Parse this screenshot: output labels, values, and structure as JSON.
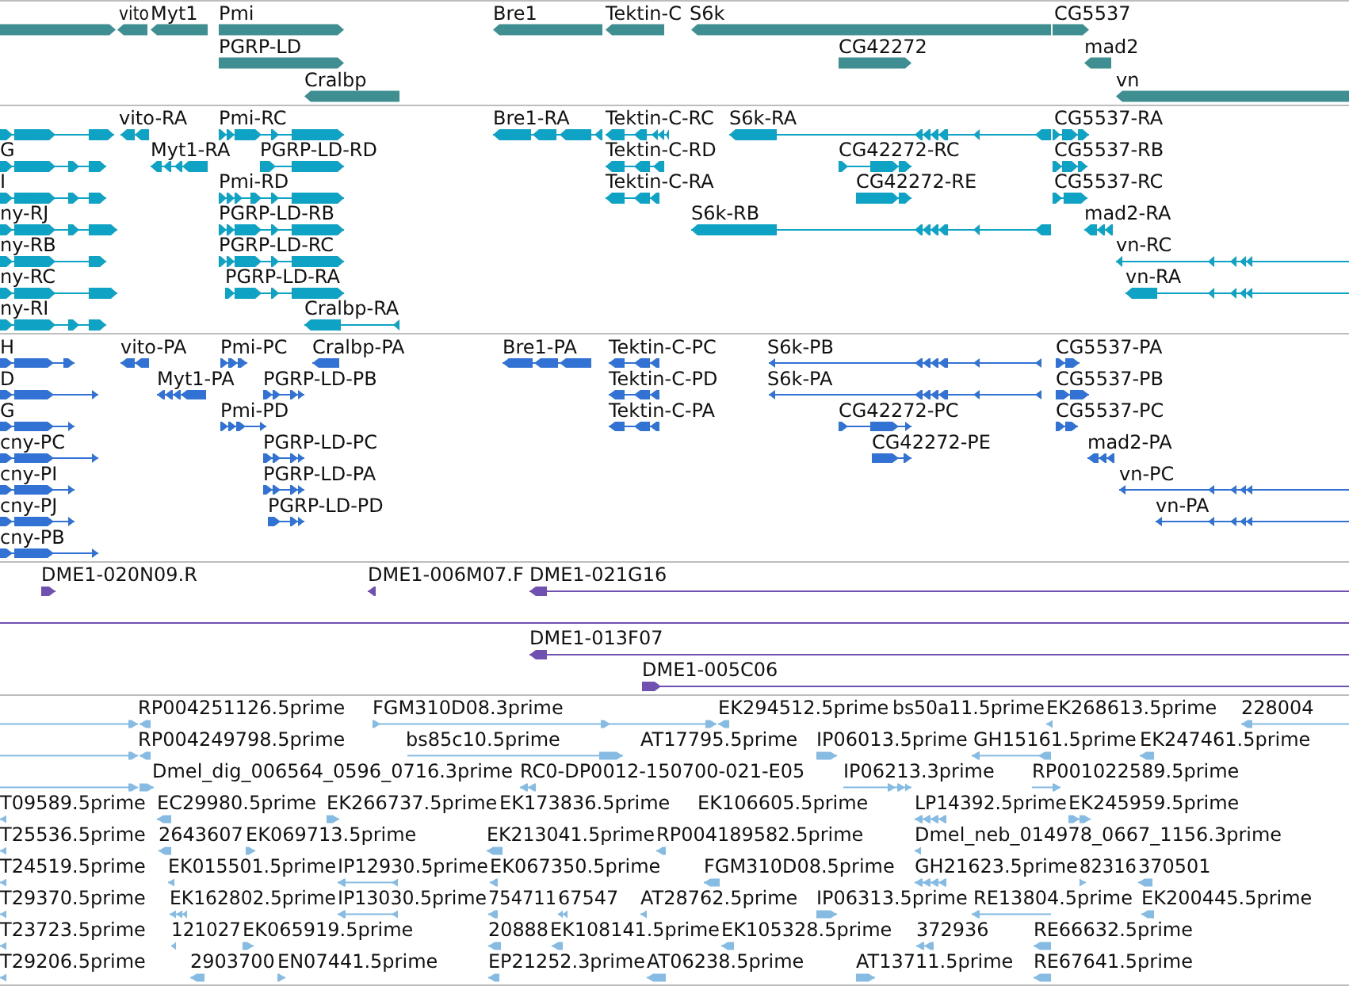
{
  "tracks": [
    {
      "kind": "gene",
      "rows": [
        {
          "features": [
            {
              "reverse": false
            },
            {
              "label": "vito",
              "reverse": true
            },
            {
              "label": "Myt1",
              "reverse": true
            },
            {
              "label": "Pmi",
              "reverse": false
            },
            {
              "label": "Bre1",
              "reverse": true
            },
            {
              "label": "Tektin-C",
              "reverse": true
            },
            {
              "label": "S6k",
              "reverse": true
            },
            {
              "label": "CG5537",
              "reverse": false
            }
          ]
        },
        {
          "features": [
            {
              "label": "PGRP-LD",
              "reverse": false
            },
            {
              "label": "CG42272",
              "reverse": false
            },
            {
              "label": "mad2",
              "reverse": true
            }
          ]
        },
        {
          "features": [
            {
              "label": "Cralbp",
              "reverse": true
            },
            {
              "label": "vn",
              "reverse": true
            }
          ]
        }
      ]
    },
    {
      "kind": "transcript",
      "rows": [
        {
          "features": [
            {
              "reverse": false
            },
            {
              "label": "vito-RA",
              "reverse": true
            },
            {
              "label": "Pmi-RC",
              "reverse": false
            },
            {
              "label": "Bre1-RA",
              "reverse": true
            },
            {
              "label": "Tektin-C-RC",
              "reverse": true
            },
            {
              "label": "S6k-RA",
              "reverse": true
            },
            {
              "label": "CG5537-RA",
              "reverse": false
            }
          ]
        },
        {
          "features": [
            {
              "label": "G",
              "reverse": false
            },
            {
              "label": "Myt1-RA",
              "reverse": true
            },
            {
              "label": "PGRP-LD-RD",
              "reverse": false
            },
            {
              "label": "Tektin-C-RD",
              "reverse": true
            },
            {
              "label": "CG42272-RC",
              "reverse": false
            },
            {
              "label": "CG5537-RB",
              "reverse": false
            }
          ]
        },
        {
          "features": [
            {
              "label": "I",
              "reverse": false
            },
            {
              "label": "Pmi-RD",
              "reverse": false
            },
            {
              "label": "Tektin-C-RA",
              "reverse": true
            },
            {
              "label": "CG42272-RE",
              "reverse": false
            },
            {
              "label": "CG5537-RC",
              "reverse": false
            }
          ]
        },
        {
          "features": [
            {
              "label": "ny-RJ",
              "reverse": false
            },
            {
              "label": "PGRP-LD-RB",
              "reverse": false
            },
            {
              "label": "S6k-RB",
              "reverse": true
            },
            {
              "label": "mad2-RA",
              "reverse": true
            }
          ]
        },
        {
          "features": [
            {
              "label": "ny-RB",
              "reverse": false
            },
            {
              "label": "PGRP-LD-RC",
              "reverse": false
            },
            {
              "label": "vn-RC",
              "reverse": true
            }
          ]
        },
        {
          "features": [
            {
              "label": "ny-RC",
              "reverse": false
            },
            {
              "label": "PGRP-LD-RA",
              "reverse": false
            },
            {
              "label": "vn-RA",
              "reverse": true
            }
          ]
        },
        {
          "features": [
            {
              "label": "ny-RI",
              "reverse": false
            },
            {
              "label": "Cralbp-RA",
              "reverse": true
            }
          ]
        }
      ]
    },
    {
      "kind": "protein",
      "rows": [
        {
          "features": [
            {
              "label": "H",
              "reverse": false
            },
            {
              "label": "vito-PA",
              "reverse": true
            },
            {
              "label": "Pmi-PC",
              "reverse": false
            },
            {
              "label": "Cralbp-PA",
              "reverse": true
            },
            {
              "label": "Bre1-PA",
              "reverse": true
            },
            {
              "label": "Tektin-C-PC",
              "reverse": true
            },
            {
              "label": "S6k-PB",
              "reverse": true
            },
            {
              "label": "CG5537-PA",
              "reverse": false
            }
          ]
        },
        {
          "features": [
            {
              "label": "D",
              "reverse": false
            },
            {
              "label": "Myt1-PA",
              "reverse": true
            },
            {
              "label": "PGRP-LD-PB",
              "reverse": false
            },
            {
              "label": "Tektin-C-PD",
              "reverse": true
            },
            {
              "label": "S6k-PA",
              "reverse": true
            },
            {
              "label": "CG5537-PB",
              "reverse": false
            }
          ]
        },
        {
          "features": [
            {
              "label": "G",
              "reverse": false
            },
            {
              "label": "Pmi-PD",
              "reverse": false
            },
            {
              "label": "Tektin-C-PA",
              "reverse": true
            },
            {
              "label": "CG42272-PC",
              "reverse": false
            },
            {
              "label": "CG5537-PC",
              "reverse": false
            }
          ]
        },
        {
          "features": [
            {
              "label": "cny-PC",
              "reverse": false
            },
            {
              "label": "PGRP-LD-PC",
              "reverse": false
            },
            {
              "label": "CG42272-PE",
              "reverse": false
            },
            {
              "label": "mad2-PA",
              "reverse": true
            }
          ]
        },
        {
          "features": [
            {
              "label": "cny-PI",
              "reverse": false
            },
            {
              "label": "PGRP-LD-PA",
              "reverse": false
            },
            {
              "label": "vn-PC",
              "reverse": true
            }
          ]
        },
        {
          "features": [
            {
              "label": "cny-PJ",
              "reverse": false
            },
            {
              "label": "PGRP-LD-PD",
              "reverse": false
            },
            {
              "label": "vn-PA",
              "reverse": true
            }
          ]
        },
        {
          "features": [
            {
              "label": "cny-PB",
              "reverse": false
            }
          ]
        }
      ]
    },
    {
      "kind": "clone",
      "rows": [
        {
          "features": [
            {
              "label": "DME1-020N09.R",
              "reverse": false
            },
            {
              "label": "DME1-006M07.F",
              "reverse": true
            },
            {
              "label": "DME1-021G16",
              "reverse": true
            }
          ]
        },
        {
          "features": [
            {
              "spans_view": true
            }
          ]
        },
        {
          "features": [
            {
              "label": "DME1-013F07",
              "reverse": true
            }
          ]
        },
        {
          "features": [
            {
              "label": "DME1-005C06",
              "reverse": false
            }
          ]
        }
      ]
    },
    {
      "kind": "est",
      "rows": [
        {
          "features": [
            {
              "reverse": false
            },
            {
              "label": "RP004251126.5prime",
              "reverse": true
            },
            {
              "label": "FGM310D08.3prime",
              "reverse": false
            },
            {
              "label": "EK294512.5prime",
              "reverse": true
            },
            {
              "label": "bs50a11.5prime"
            },
            {
              "label": "EK268613.5prime",
              "reverse": true
            },
            {
              "label": "228004",
              "reverse": true
            }
          ]
        },
        {
          "features": [
            {
              "reverse": false
            },
            {
              "label": "RP004249798.5prime",
              "reverse": true
            },
            {
              "label": "bs85c10.5prime",
              "reverse": false
            },
            {
              "label": "AT17795.5prime"
            },
            {
              "label": "IP06013.5prime",
              "reverse": false
            },
            {
              "label": "GH15161.5prime",
              "reverse": true
            },
            {
              "label": "EK247461.5prime",
              "reverse": true
            }
          ]
        },
        {
          "features": [
            {
              "reverse": false
            },
            {
              "label": "Dmel_dig_006564_0596_0716.3prime",
              "reverse": false
            },
            {
              "label": "RC0-DP0012-150700-021-E05",
              "reverse": true
            },
            {
              "label": "IP06213.3prime",
              "reverse": false
            },
            {
              "label": "RP001022589.5prime",
              "reverse": false
            }
          ]
        },
        {
          "features": [
            {
              "label": "T09589.5prime",
              "reverse": true
            },
            {
              "label": "EC29980.5prime",
              "reverse": true
            },
            {
              "label": "EK266737.5prime",
              "reverse": false
            },
            {
              "label": "EK173836.5prime"
            },
            {
              "label": "EK106605.5prime"
            },
            {
              "label": "LP14392.5prime",
              "reverse": true
            },
            {
              "label": "EK245959.5prime",
              "reverse": false
            }
          ]
        },
        {
          "features": [
            {
              "label": "T25536.5prime",
              "reverse": true
            },
            {
              "label": "2643607",
              "reverse": true
            },
            {
              "label": "EK069713.5prime",
              "reverse": false
            },
            {
              "label": "EK213041.5prime",
              "reverse": true
            },
            {
              "label": "RP004189582.5prime",
              "reverse": true
            },
            {
              "label": "Dmel_neb_014978_0667_1156.3prime",
              "reverse": true
            }
          ]
        },
        {
          "features": [
            {
              "label": "T24519.5prime",
              "reverse": true
            },
            {
              "label": "EK015501.5prime",
              "reverse": true
            },
            {
              "label": "IP12930.5prime",
              "reverse": true
            },
            {
              "label": "EK067350.5prime",
              "reverse": true
            },
            {
              "label": "FGM310D08.5prime",
              "reverse": true
            },
            {
              "label": "GH21623.5prime",
              "reverse": true
            },
            {
              "label": "82316",
              "reverse": false
            },
            {
              "label": "370501",
              "reverse": true
            }
          ]
        },
        {
          "features": [
            {
              "label": "T29370.5prime",
              "reverse": true
            },
            {
              "label": "EK162802.5prime",
              "reverse": true
            },
            {
              "label": "IP13030.5prime",
              "reverse": true
            },
            {
              "label": "754711",
              "reverse": true
            },
            {
              "label": "67547",
              "reverse": true
            },
            {
              "label": "AT28762.5prime",
              "reverse": true
            },
            {
              "label": "IP06313.5prime",
              "reverse": false
            },
            {
              "label": "RE13804.5prime",
              "reverse": true
            },
            {
              "label": "EK200445.5prime",
              "reverse": true
            }
          ]
        },
        {
          "features": [
            {
              "label": "T23723.5prime",
              "reverse": true
            },
            {
              "label": "121027",
              "reverse": true
            },
            {
              "label": "EK065919.5prime",
              "reverse": false
            },
            {
              "label": "20888",
              "reverse": true
            },
            {
              "label": "EK108141.5prime",
              "reverse": true
            },
            {
              "label": "EK105328.5prime",
              "reverse": true
            },
            {
              "label": "372936",
              "reverse": true
            },
            {
              "label": "RE66632.5prime",
              "reverse": true
            }
          ]
        },
        {
          "features": [
            {
              "label": "T29206.5prime",
              "reverse": true
            },
            {
              "label": "2903700",
              "reverse": true
            },
            {
              "label": "EN07441.5prime",
              "reverse": false
            },
            {
              "label": "EP21252.3prime",
              "reverse": true
            },
            {
              "label": "AT06238.5prime",
              "reverse": true
            },
            {
              "label": "AT13711.5prime",
              "reverse": false
            },
            {
              "label": "RE67641.5prime",
              "reverse": true
            }
          ]
        }
      ]
    }
  ]
}
